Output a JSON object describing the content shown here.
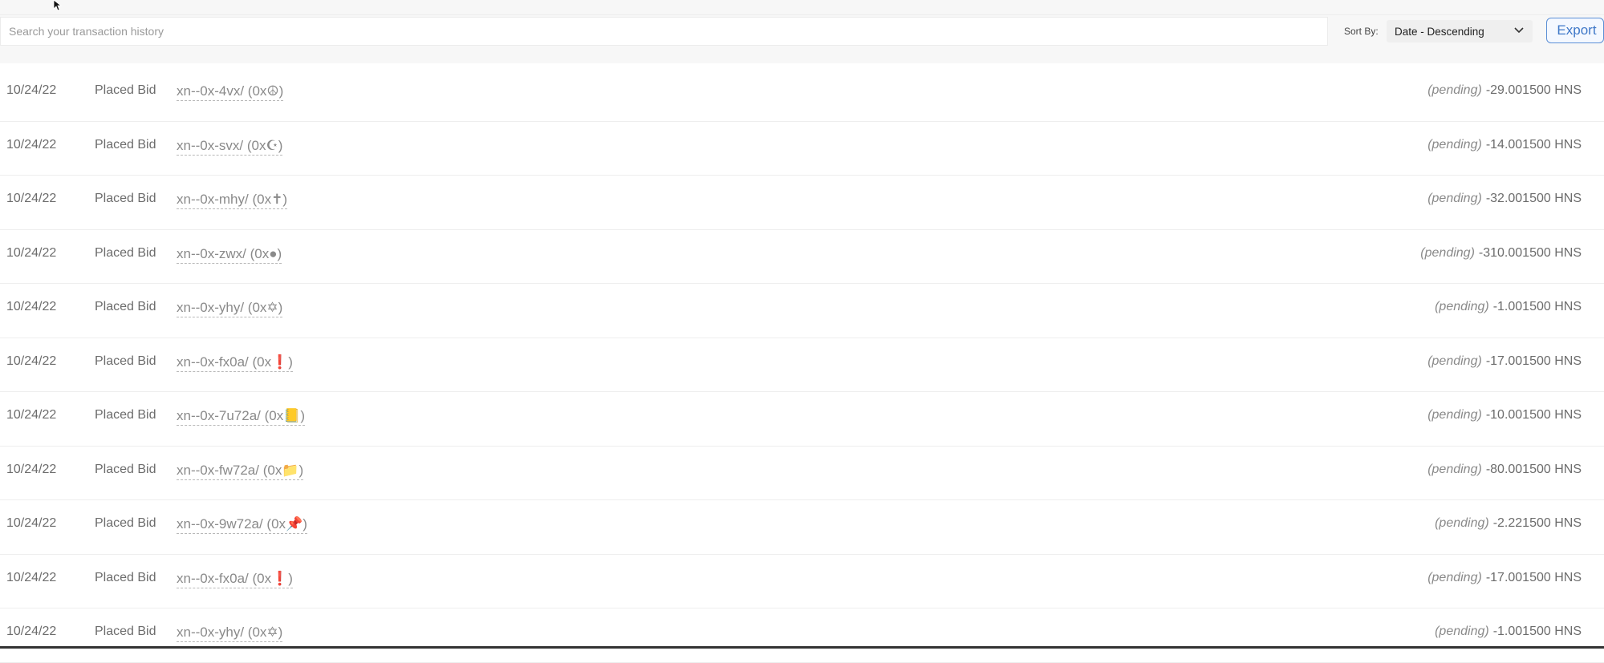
{
  "search": {
    "placeholder": "Search your transaction history"
  },
  "sort": {
    "label": "Sort By:",
    "value": "Date - Descending"
  },
  "export_label": "Export",
  "transactions": [
    {
      "date": "10/24/22",
      "action": "Placed Bid",
      "name": "xn--0x-4vx/ (0x☮)",
      "status": "(pending)",
      "amount": "-29.001500 HNS"
    },
    {
      "date": "10/24/22",
      "action": "Placed Bid",
      "name": "xn--0x-svx/ (0x☪)",
      "status": "(pending)",
      "amount": "-14.001500 HNS"
    },
    {
      "date": "10/24/22",
      "action": "Placed Bid",
      "name": "xn--0x-mhy/ (0x✝)",
      "status": "(pending)",
      "amount": "-32.001500 HNS"
    },
    {
      "date": "10/24/22",
      "action": "Placed Bid",
      "name": "xn--0x-zwx/ (0x●)",
      "status": "(pending)",
      "amount": "-310.001500 HNS"
    },
    {
      "date": "10/24/22",
      "action": "Placed Bid",
      "name": "xn--0x-yhy/ (0x✡)",
      "status": "(pending)",
      "amount": "-1.001500 HNS"
    },
    {
      "date": "10/24/22",
      "action": "Placed Bid",
      "name": "xn--0x-fx0a/ (0x❗)",
      "status": "(pending)",
      "amount": "-17.001500 HNS"
    },
    {
      "date": "10/24/22",
      "action": "Placed Bid",
      "name": "xn--0x-7u72a/ (0x📒)",
      "status": "(pending)",
      "amount": "-10.001500 HNS"
    },
    {
      "date": "10/24/22",
      "action": "Placed Bid",
      "name": "xn--0x-fw72a/ (0x📁)",
      "status": "(pending)",
      "amount": "-80.001500 HNS"
    },
    {
      "date": "10/24/22",
      "action": "Placed Bid",
      "name": "xn--0x-9w72a/ (0x📌)",
      "status": "(pending)",
      "amount": "-2.221500 HNS"
    },
    {
      "date": "10/24/22",
      "action": "Placed Bid",
      "name": "xn--0x-fx0a/ (0x❗)",
      "status": "(pending)",
      "amount": "-17.001500 HNS"
    },
    {
      "date": "10/24/22",
      "action": "Placed Bid",
      "name": "xn--0x-yhy/ (0x✡)",
      "status": "(pending)",
      "amount": "-1.001500 HNS"
    }
  ]
}
